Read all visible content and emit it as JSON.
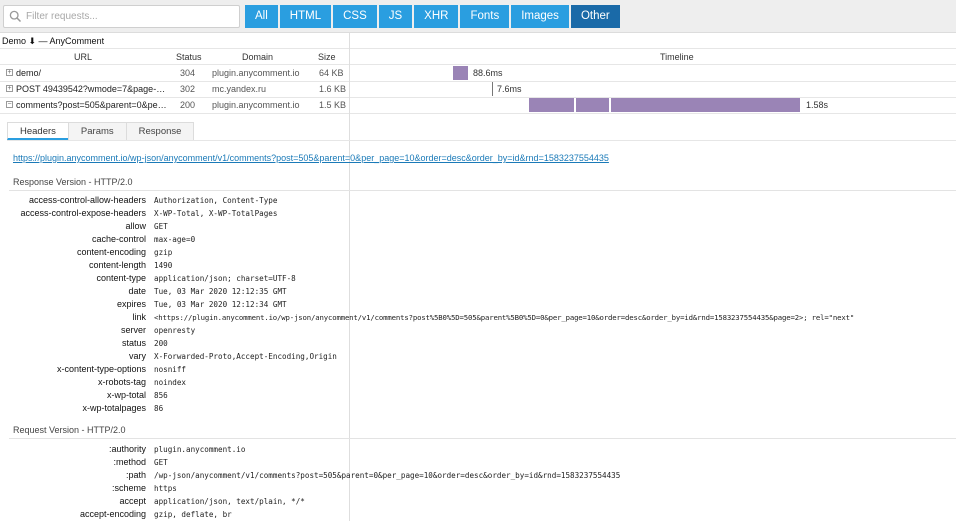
{
  "toolbar": {
    "search_placeholder": "Filter requests...",
    "filters": [
      {
        "label": "All",
        "active": false
      },
      {
        "label": "HTML",
        "active": false
      },
      {
        "label": "CSS",
        "active": false
      },
      {
        "label": "JS",
        "active": false
      },
      {
        "label": "XHR",
        "active": false
      },
      {
        "label": "Fonts",
        "active": false
      },
      {
        "label": "Images",
        "active": false
      },
      {
        "label": "Other",
        "active": true
      }
    ]
  },
  "group_title": "Demo ⬇ — AnyComment",
  "columns": {
    "url": "URL",
    "status": "Status",
    "domain": "Domain",
    "size": "Size",
    "timeline": "Timeline"
  },
  "requests": [
    {
      "expander": "+",
      "url": "demo/",
      "status": "304",
      "domain": "plugin.anycomment.io",
      "size": "64 KB",
      "time": "88.6ms"
    },
    {
      "expander": "+",
      "url": "POST 49439542?wmode=7&page-url=https%3A%2F",
      "status": "302",
      "domain": "mc.yandex.ru",
      "size": "1.6 KB",
      "time": "7.6ms"
    },
    {
      "expander": "−",
      "url": "comments?post=505&parent=0&per_page=10",
      "status": "200",
      "domain": "plugin.anycomment.io",
      "size": "1.5 KB",
      "time": "1.58s"
    }
  ],
  "tabs": [
    {
      "label": "Headers",
      "active": true
    },
    {
      "label": "Params",
      "active": false
    },
    {
      "label": "Response",
      "active": false
    }
  ],
  "request_url": "https://plugin.anycomment.io/wp-json/anycomment/v1/comments?post=505&parent=0&per_page=10&order=desc&order_by=id&rnd=1583237554435",
  "response_section": {
    "title": "Response Version - HTTP/2.0",
    "headers": [
      {
        "name": "access-control-allow-headers",
        "value": "Authorization, Content-Type"
      },
      {
        "name": "access-control-expose-headers",
        "value": "X-WP-Total, X-WP-TotalPages"
      },
      {
        "name": "allow",
        "value": "GET"
      },
      {
        "name": "cache-control",
        "value": "max-age=0"
      },
      {
        "name": "content-encoding",
        "value": "gzip"
      },
      {
        "name": "content-length",
        "value": "1490"
      },
      {
        "name": "content-type",
        "value": "application/json; charset=UTF-8"
      },
      {
        "name": "date",
        "value": "Tue, 03 Mar 2020 12:12:35 GMT"
      },
      {
        "name": "expires",
        "value": "Tue, 03 Mar 2020 12:12:34 GMT"
      },
      {
        "name": "link",
        "value": "<https://plugin.anycomment.io/wp-json/anycomment/v1/comments?post%5B0%5D=505&parent%5B0%5D=0&per_page=10&order=desc&order_by=id&rnd=1583237554435&page=2>; rel=\"next\""
      },
      {
        "name": "server",
        "value": "openresty"
      },
      {
        "name": "status",
        "value": "200"
      },
      {
        "name": "vary",
        "value": "X-Forwarded-Proto,Accept-Encoding,Origin"
      },
      {
        "name": "x-content-type-options",
        "value": "nosniff"
      },
      {
        "name": "x-robots-tag",
        "value": "noindex"
      },
      {
        "name": "x-wp-total",
        "value": "856"
      },
      {
        "name": "x-wp-totalpages",
        "value": "86"
      }
    ]
  },
  "request_section": {
    "title": "Request Version - HTTP/2.0",
    "headers": [
      {
        "name": ":authority",
        "value": "plugin.anycomment.io"
      },
      {
        "name": ":method",
        "value": "GET"
      },
      {
        "name": ":path",
        "value": "/wp-json/anycomment/v1/comments?post=505&parent=0&per_page=10&order=desc&order_by=id&rnd=1583237554435"
      },
      {
        "name": ":scheme",
        "value": "https"
      },
      {
        "name": "accept",
        "value": "application/json, text/plain, */*"
      },
      {
        "name": "accept-encoding",
        "value": "gzip, deflate, br"
      }
    ]
  },
  "colors": {
    "accent": "#2a9ee0",
    "accent_active": "#1a6aa8",
    "timeline_bar": "#9a84b6",
    "link": "#1a7ab8"
  }
}
